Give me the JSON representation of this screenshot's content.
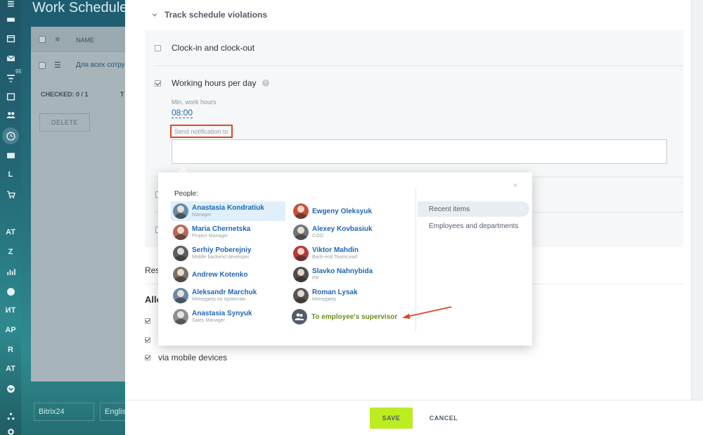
{
  "background": {
    "title": "Work Schedule",
    "header_name": "NAME",
    "row_link": "Для всех сотру",
    "checked_label": "CHECKED: 0 / 1",
    "checked_trunc": "T",
    "delete_label": "DELETE",
    "footer_logo": "Bitrix24",
    "footer_lang": "English",
    "rail_counter": "99+",
    "rail_letters": [
      "L",
      "AT",
      "Z",
      "ИТ",
      "AP",
      "R",
      "AT"
    ]
  },
  "section": {
    "title": "Track schedule violations"
  },
  "options": {
    "clock_in_label": "Clock-in and clock-out",
    "working_hours_label": "Working hours per day",
    "min_hours_label": "Min. work hours",
    "min_hours_value": "08:00",
    "notify_label": "Send notification to"
  },
  "lower": {
    "res_text": "Res",
    "allo_text": "Allo",
    "mobile_label": "via mobile devices"
  },
  "popup": {
    "close": "×",
    "people_title": "People:",
    "people": [
      {
        "name": "Anastasia Kondratiuk",
        "role": "Manager",
        "color": "#6d8aa0"
      },
      {
        "name": "Ewgeny Oleksyuk",
        "role": "",
        "color": "#c8503a"
      },
      {
        "name": "Maria Chernetska",
        "role": "Project Manager",
        "color": "#b7685b"
      },
      {
        "name": "Alexey Kovbasiuk",
        "role": "COO",
        "color": "#6f7478"
      },
      {
        "name": "Serhiy Poberejniy",
        "role": "Middle backend developer",
        "color": "#5b5e62"
      },
      {
        "name": "Viktor Mahdin",
        "role": "Back-end TeamLead",
        "color": "#b33a3a"
      },
      {
        "name": "Andrew Kotenko",
        "role": "",
        "color": "#7a7064"
      },
      {
        "name": "Slavko Nahnybida",
        "role": "PR",
        "color": "#4e4e4e"
      },
      {
        "name": "Aleksandr Marchuk",
        "role": "Менеджер по проектам",
        "color": "#6a8aa8"
      },
      {
        "name": "Roman Lysak",
        "role": "Менеджер",
        "color": "#565656"
      },
      {
        "name": "Anastasia Synyuk",
        "role": "Sales Manager",
        "color": "#8c8f93"
      }
    ],
    "supervisor_label": "To employee's supervisor",
    "tab_recent": "Recent items",
    "tab_employees": "Employees and departments"
  },
  "footer": {
    "save_label": "SAVE",
    "cancel_label": "CANCEL"
  },
  "colors": {
    "accent_green": "#bbed21",
    "link_blue": "#2067b0",
    "highlight_red": "#e0472a",
    "supervisor_green": "#6d8c1b"
  }
}
